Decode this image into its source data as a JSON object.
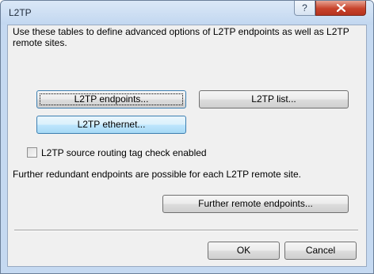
{
  "window": {
    "title": "L2TP",
    "help_label": "?"
  },
  "content": {
    "description": "Use these tables to define advanced options of L2TP endpoints as well as L2TP remote sites.",
    "buttons": {
      "endpoints": "L2TP endpoints...",
      "list": "L2TP list...",
      "ethernet": "L2TP ethernet..."
    },
    "checkbox": {
      "label": "L2TP source routing tag check enabled",
      "checked": false
    },
    "note": "Further redundant endpoints are possible for each L2TP remote site.",
    "further_button": "Further remote endpoints..."
  },
  "footer": {
    "ok": "OK",
    "cancel": "Cancel"
  }
}
